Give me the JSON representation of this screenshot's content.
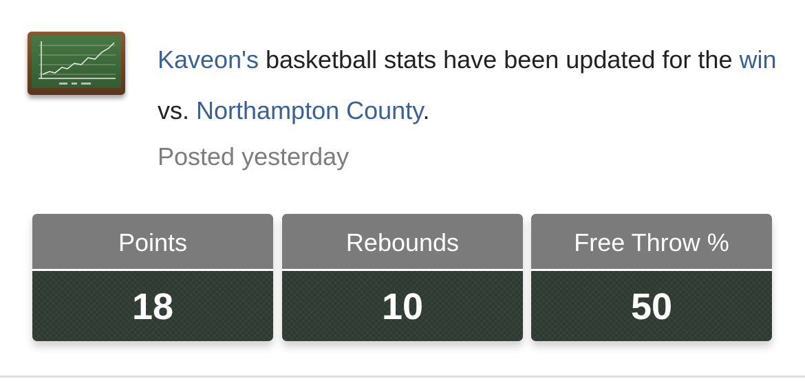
{
  "post": {
    "icon": "chalkboard-chart-icon",
    "player_name": "Kaveon's",
    "text_part1": " basketball stats have been updated for the ",
    "result": "win",
    "text_part2": " vs. ",
    "opponent": "Northampton County",
    "text_part3": ".",
    "timestamp": "Posted yesterday"
  },
  "stats": [
    {
      "label": "Points",
      "value": "18"
    },
    {
      "label": "Rebounds",
      "value": "10"
    },
    {
      "label": "Free Throw %",
      "value": "50"
    }
  ],
  "colors": {
    "link": "#3b6194",
    "text": "#222222",
    "muted": "#7d7d7d",
    "stat_header": "#7b7b7b",
    "stat_body": "#2f3a33"
  }
}
